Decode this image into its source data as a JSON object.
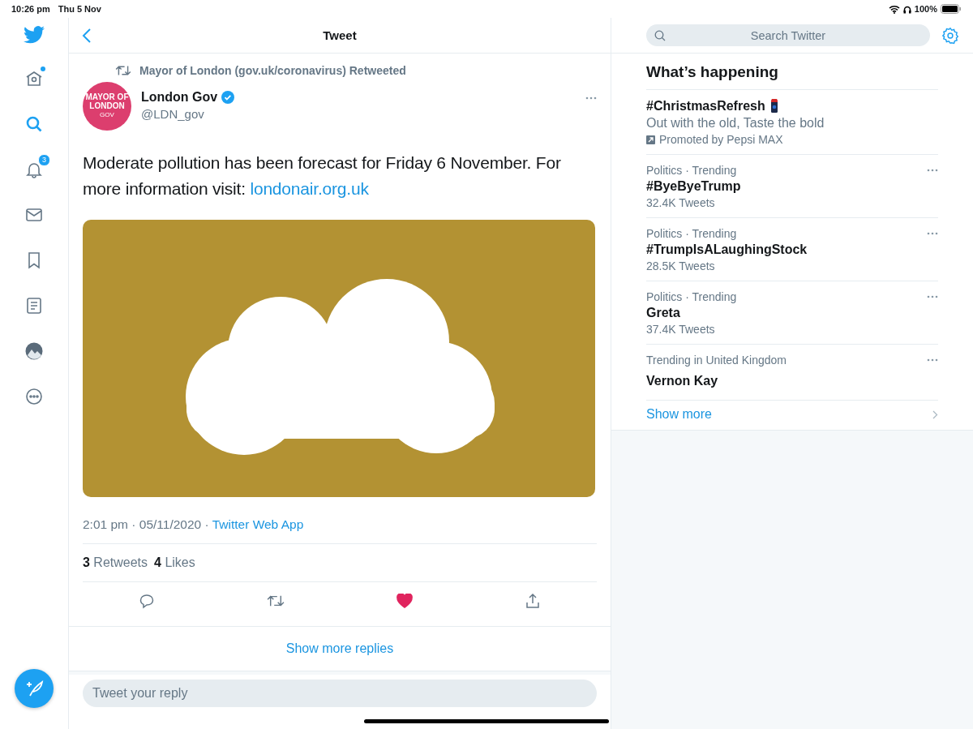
{
  "status_bar": {
    "time": "10:26 pm",
    "date": "Thu 5 Nov",
    "battery": "100%"
  },
  "sidebar": {
    "items": [
      {
        "kind": "home",
        "selected": false,
        "dot": true
      },
      {
        "kind": "search",
        "selected": true
      },
      {
        "kind": "notifications",
        "selected": false,
        "badge": "3"
      },
      {
        "kind": "messages",
        "selected": false
      },
      {
        "kind": "bookmarks",
        "selected": false
      },
      {
        "kind": "lists",
        "selected": false
      },
      {
        "kind": "profile",
        "selected": false
      },
      {
        "kind": "more",
        "selected": false
      }
    ]
  },
  "header": {
    "title": "Tweet"
  },
  "tweet": {
    "retweeted_by": "Mayor of London (gov.uk/coronavirus) Retweeted",
    "avatar": {
      "lines": [
        "MAYOR OF",
        "LONDON",
        "GOV"
      ]
    },
    "name": "London Gov",
    "verified": true,
    "handle": "@LDN_gov",
    "text": "Moderate pollution has been forecast for Friday 6 November. For more information visit: ",
    "link": "londonair.org.uk",
    "time": "2:01 pm · 05/11/2020 · ",
    "source": "Twitter Web App",
    "stats": [
      {
        "count": "3",
        "label": "Retweets"
      },
      {
        "count": "4",
        "label": "Likes"
      }
    ],
    "liked": true
  },
  "show_more_replies": "Show more replies",
  "reply": {
    "placeholder": "Tweet your reply"
  },
  "search": {
    "placeholder": "Search Twitter"
  },
  "trends": {
    "title": "What’s happening",
    "items": [
      {
        "kind": "promoted",
        "name": "#ChristmasRefresh",
        "description": "Out with the old, Taste the bold",
        "promoter": "Promoted by Pepsi MAX"
      },
      {
        "kind": "trend",
        "context": "Politics · Trending",
        "name": "#ByeByeTrump",
        "count": "32.4K Tweets"
      },
      {
        "kind": "trend",
        "context": "Politics · Trending",
        "name": "#TrumpIsALaughingStock",
        "count": "28.5K Tweets"
      },
      {
        "kind": "trend",
        "context": "Politics · Trending",
        "name": "Greta",
        "count": "37.4K Tweets"
      },
      {
        "kind": "trend",
        "context": "Trending in United Kingdom",
        "name": "Vernon Kay"
      }
    ],
    "show_more": "Show more"
  }
}
